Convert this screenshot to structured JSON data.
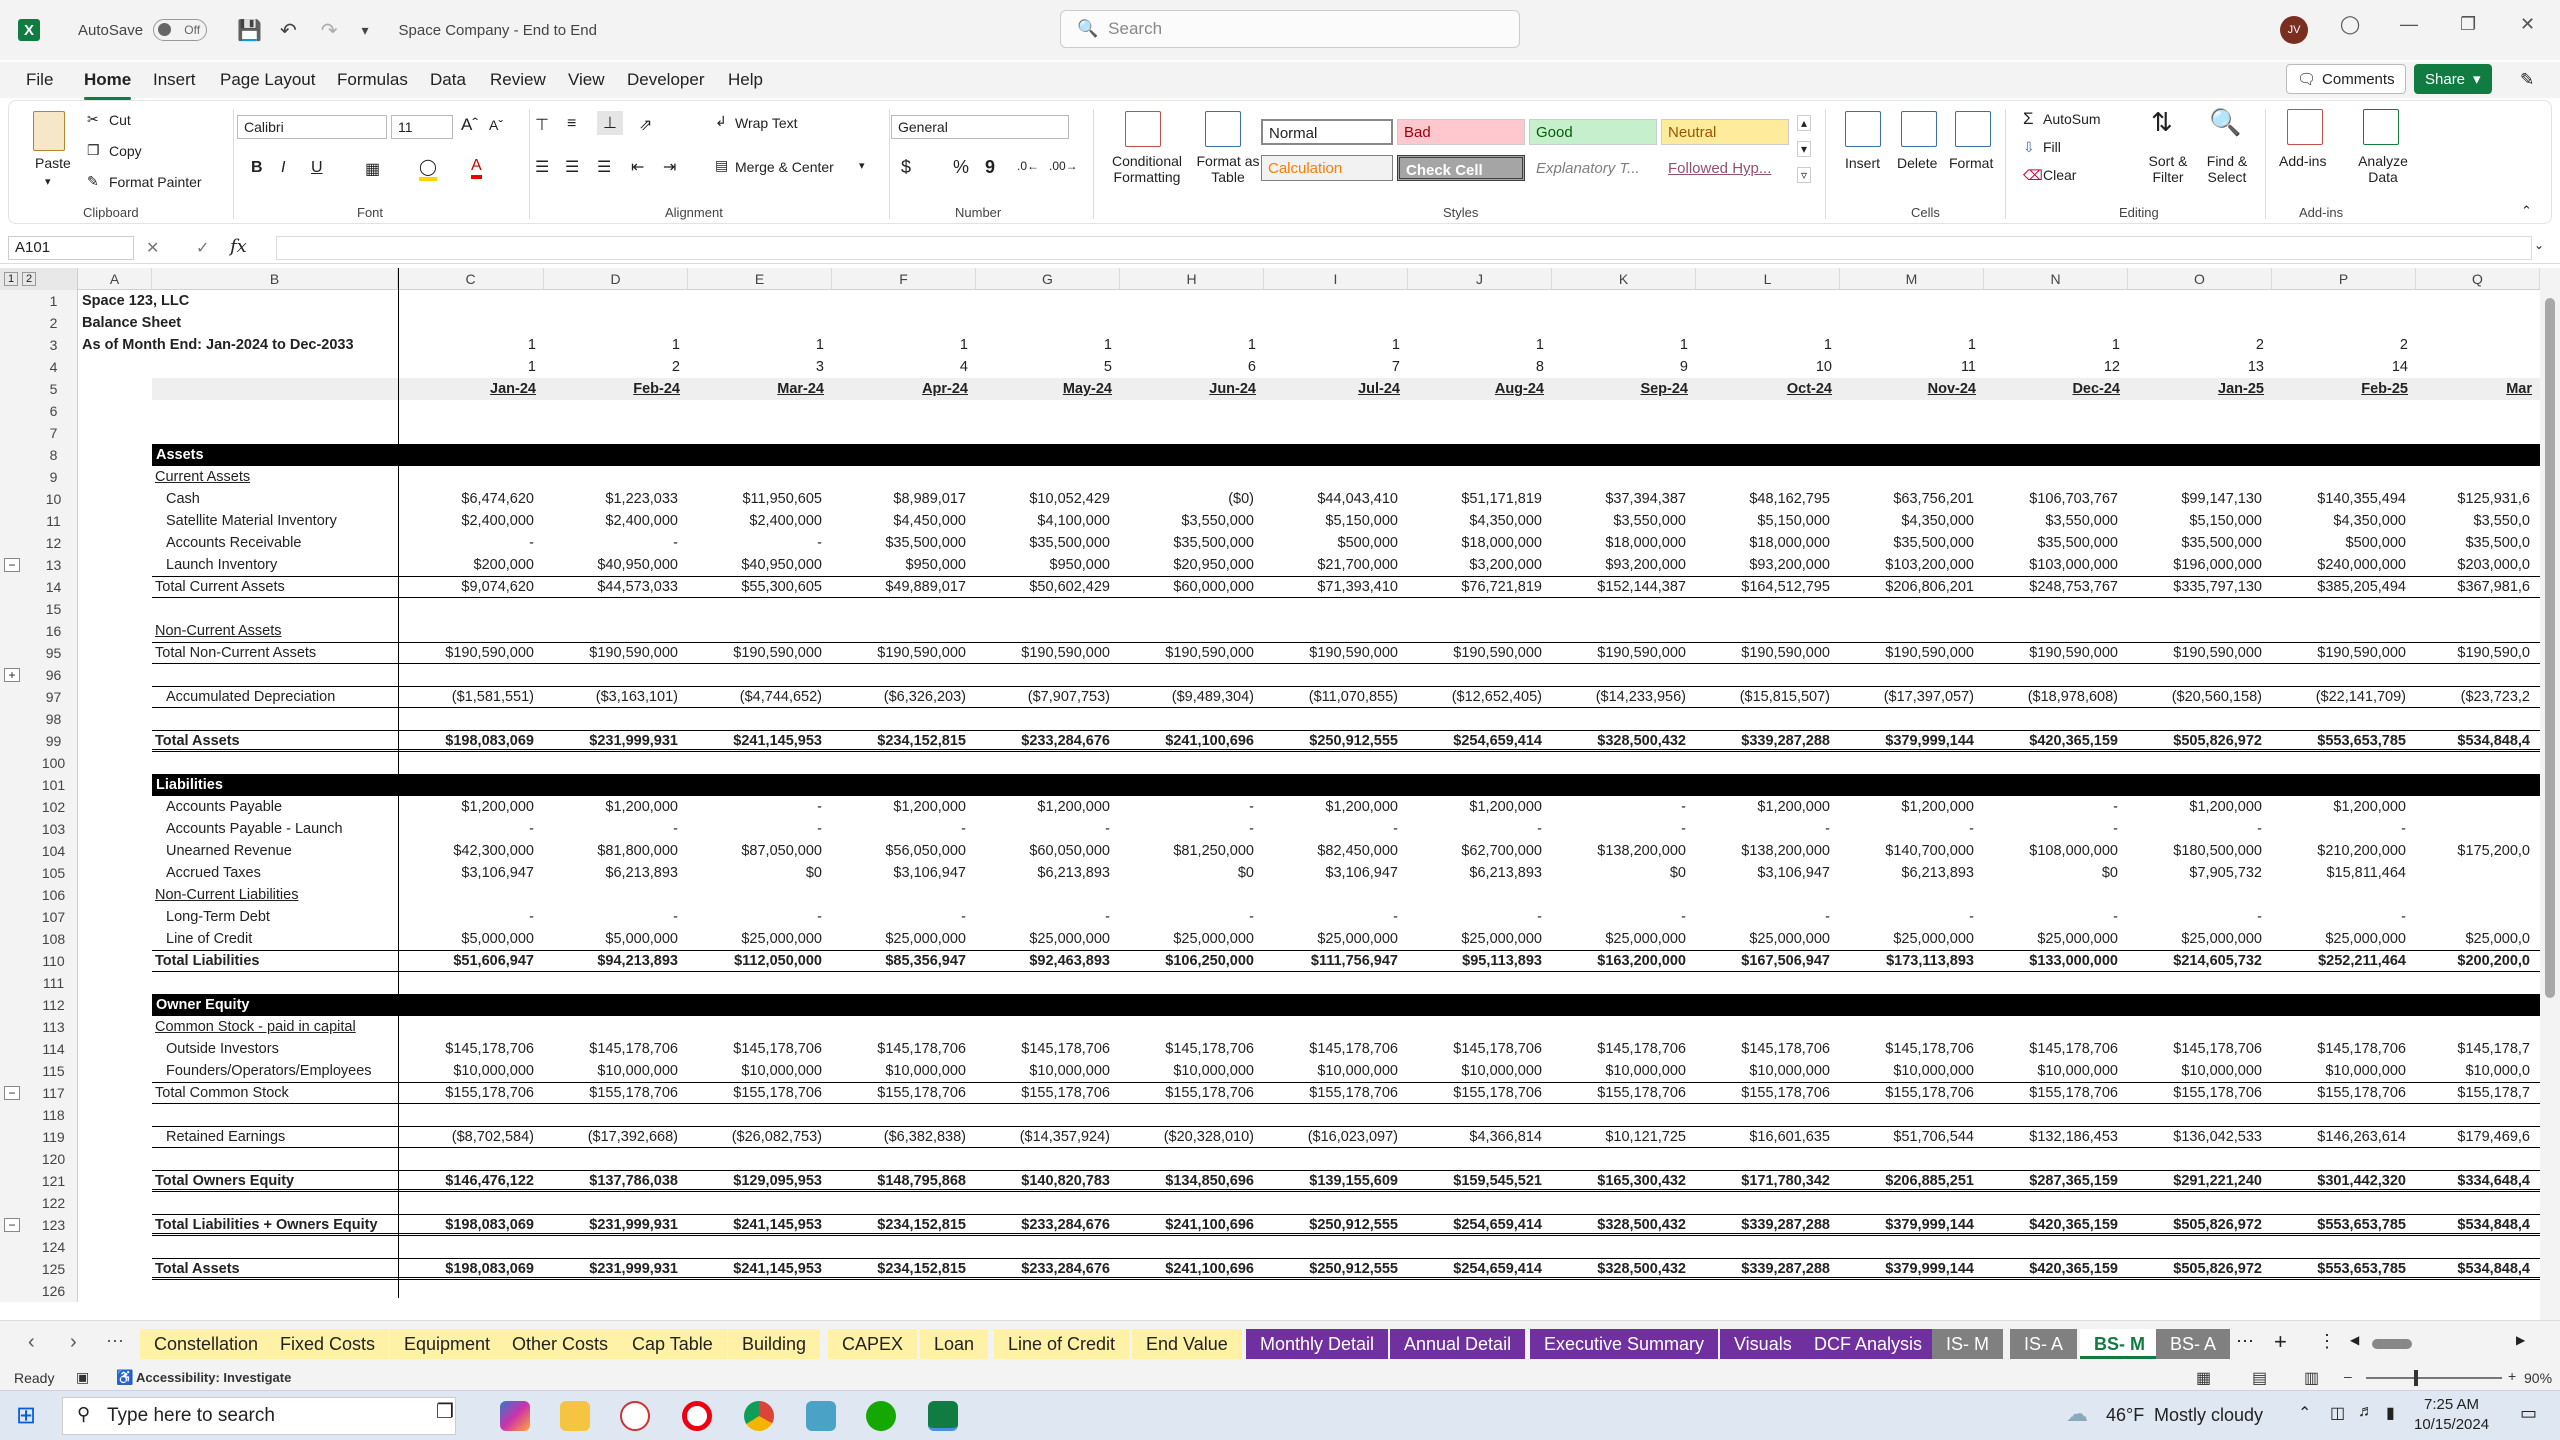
{
  "title_bar": {
    "autosave_label": "AutoSave",
    "autosave_state": "Off",
    "document_title": "Space Company - End to End",
    "search_placeholder": "Search",
    "user_initials": "JV"
  },
  "menu": {
    "items": [
      "File",
      "Home",
      "Insert",
      "Page Layout",
      "Formulas",
      "Data",
      "Review",
      "View",
      "Developer",
      "Help"
    ],
    "active": "Home",
    "comments_label": "Comments",
    "share_label": "Share"
  },
  "ribbon": {
    "clipboard": {
      "paste": "Paste",
      "cut": "Cut",
      "copy": "Copy",
      "format_painter": "Format Painter",
      "group": "Clipboard"
    },
    "font": {
      "name": "Calibri",
      "size": "11",
      "group": "Font"
    },
    "alignment": {
      "wrap_text": "Wrap Text",
      "merge_center": "Merge & Center",
      "group": "Alignment"
    },
    "number": {
      "format": "General",
      "group": "Number"
    },
    "styles": {
      "conditional_formatting": "Conditional Formatting",
      "format_as_table": "Format as Table",
      "cells": [
        "Normal",
        "Bad",
        "Good",
        "Neutral",
        "Calculation",
        "Check Cell",
        "Explanatory T...",
        "Followed Hyp..."
      ],
      "group": "Styles"
    },
    "cells": {
      "insert": "Insert",
      "delete": "Delete",
      "format": "Format",
      "group": "Cells"
    },
    "editing": {
      "autosum": "AutoSum",
      "fill": "Fill",
      "clear": "Clear",
      "sort_filter": "Sort & Filter",
      "find_select": "Find & Select",
      "group": "Editing"
    },
    "addins": {
      "addins": "Add-ins",
      "analyze": "Analyze Data",
      "group": "Add-ins"
    }
  },
  "formula_bar": {
    "name_box": "A101",
    "formula": ""
  },
  "columns": [
    "A",
    "B",
    "C",
    "D",
    "E",
    "F",
    "G",
    "H",
    "I",
    "J",
    "K",
    "L",
    "M",
    "N",
    "O",
    "P",
    "Q"
  ],
  "sheet": {
    "company": "Space 123, LLC",
    "statement": "Balance Sheet",
    "period": "As of Month End: Jan-2024 to Dec-2033",
    "year_index": [
      "1",
      "1",
      "1",
      "1",
      "1",
      "1",
      "1",
      "1",
      "1",
      "1",
      "1",
      "1",
      "2",
      "2",
      ""
    ],
    "month_index": [
      "1",
      "2",
      "3",
      "4",
      "5",
      "6",
      "7",
      "8",
      "9",
      "10",
      "11",
      "12",
      "13",
      "14",
      ""
    ],
    "months": [
      "Jan-24",
      "Feb-24",
      "Mar-24",
      "Apr-24",
      "May-24",
      "Jun-24",
      "Jul-24",
      "Aug-24",
      "Sep-24",
      "Oct-24",
      "Nov-24",
      "Dec-24",
      "Jan-25",
      "Feb-25",
      "Mar"
    ],
    "rows": [
      {
        "n": "6",
        "type": "blank"
      },
      {
        "n": "7",
        "type": "blank"
      },
      {
        "n": "8",
        "type": "header",
        "label": "Assets"
      },
      {
        "n": "9",
        "type": "sub",
        "label": "Current Assets"
      },
      {
        "n": "10",
        "type": "item",
        "label": "Cash",
        "values": [
          "$6,474,620",
          "$1,223,033",
          "$11,950,605",
          "$8,989,017",
          "$10,052,429",
          "($0)",
          "$44,043,410",
          "$51,171,819",
          "$37,394,387",
          "$48,162,795",
          "$63,756,201",
          "$106,703,767",
          "$99,147,130",
          "$140,355,494",
          "$125,931,6"
        ]
      },
      {
        "n": "11",
        "type": "item",
        "label": "Satellite Material Inventory",
        "values": [
          "$2,400,000",
          "$2,400,000",
          "$2,400,000",
          "$4,450,000",
          "$4,100,000",
          "$3,550,000",
          "$5,150,000",
          "$4,350,000",
          "$3,550,000",
          "$5,150,000",
          "$4,350,000",
          "$3,550,000",
          "$5,150,000",
          "$4,350,000",
          "$3,550,0"
        ]
      },
      {
        "n": "12",
        "type": "item",
        "label": "Accounts Receivable",
        "values": [
          "-",
          "-",
          "-",
          "$35,500,000",
          "$35,500,000",
          "$35,500,000",
          "$500,000",
          "$18,000,000",
          "$18,000,000",
          "$18,000,000",
          "$35,500,000",
          "$35,500,000",
          "$35,500,000",
          "$500,000",
          "$35,500,0"
        ]
      },
      {
        "n": "13",
        "type": "item",
        "label": "Launch Inventory",
        "values": [
          "$200,000",
          "$40,950,000",
          "$40,950,000",
          "$950,000",
          "$950,000",
          "$20,950,000",
          "$21,700,000",
          "$3,200,000",
          "$93,200,000",
          "$93,200,000",
          "$103,200,000",
          "$103,000,000",
          "$196,000,000",
          "$240,000,000",
          "$203,000,0"
        ]
      },
      {
        "n": "14",
        "type": "total",
        "label": "Total Current Assets",
        "values": [
          "$9,074,620",
          "$44,573,033",
          "$55,300,605",
          "$49,889,017",
          "$50,602,429",
          "$60,000,000",
          "$71,393,410",
          "$76,721,819",
          "$152,144,387",
          "$164,512,795",
          "$206,806,201",
          "$248,753,767",
          "$335,797,130",
          "$385,205,494",
          "$367,981,6"
        ]
      },
      {
        "n": "15",
        "type": "blank"
      },
      {
        "n": "16",
        "type": "sub",
        "label": "Non-Current Assets"
      },
      {
        "n": "95",
        "type": "total",
        "label": "Total Non-Current Assets",
        "values": [
          "$190,590,000",
          "$190,590,000",
          "$190,590,000",
          "$190,590,000",
          "$190,590,000",
          "$190,590,000",
          "$190,590,000",
          "$190,590,000",
          "$190,590,000",
          "$190,590,000",
          "$190,590,000",
          "$190,590,000",
          "$190,590,000",
          "$190,590,000",
          "$190,590,0"
        ]
      },
      {
        "n": "96",
        "type": "blank"
      },
      {
        "n": "97",
        "type": "boxed",
        "label": "Accumulated Depreciation",
        "values": [
          "($1,581,551)",
          "($3,163,101)",
          "($4,744,652)",
          "($6,326,203)",
          "($7,907,753)",
          "($9,489,304)",
          "($11,070,855)",
          "($12,652,405)",
          "($14,233,956)",
          "($15,815,507)",
          "($17,397,057)",
          "($18,978,608)",
          "($20,560,158)",
          "($22,141,709)",
          "($23,723,2"
        ]
      },
      {
        "n": "98",
        "type": "blank"
      },
      {
        "n": "99",
        "type": "grand",
        "label": "Total Assets",
        "values": [
          "$198,083,069",
          "$231,999,931",
          "$241,145,953",
          "$234,152,815",
          "$233,284,676",
          "$241,100,696",
          "$250,912,555",
          "$254,659,414",
          "$328,500,432",
          "$339,287,288",
          "$379,999,144",
          "$420,365,159",
          "$505,826,972",
          "$553,653,785",
          "$534,848,4"
        ]
      },
      {
        "n": "100",
        "type": "blank"
      },
      {
        "n": "101",
        "type": "header",
        "label": "Liabilities"
      },
      {
        "n": "102",
        "type": "item",
        "label": "Accounts Payable",
        "values": [
          "$1,200,000",
          "$1,200,000",
          "-",
          "$1,200,000",
          "$1,200,000",
          "-",
          "$1,200,000",
          "$1,200,000",
          "-",
          "$1,200,000",
          "$1,200,000",
          "-",
          "$1,200,000",
          "$1,200,000",
          ""
        ]
      },
      {
        "n": "103",
        "type": "item",
        "label": "Accounts Payable - Launch",
        "values": [
          "-",
          "-",
          "-",
          "-",
          "-",
          "-",
          "-",
          "-",
          "-",
          "-",
          "-",
          "-",
          "-",
          "-",
          ""
        ]
      },
      {
        "n": "104",
        "type": "item",
        "label": "Unearned Revenue",
        "values": [
          "$42,300,000",
          "$81,800,000",
          "$87,050,000",
          "$56,050,000",
          "$60,050,000",
          "$81,250,000",
          "$82,450,000",
          "$62,700,000",
          "$138,200,000",
          "$138,200,000",
          "$140,700,000",
          "$108,000,000",
          "$180,500,000",
          "$210,200,000",
          "$175,200,0"
        ]
      },
      {
        "n": "105",
        "type": "item",
        "label": "Accrued Taxes",
        "values": [
          "$3,106,947",
          "$6,213,893",
          "$0",
          "$3,106,947",
          "$6,213,893",
          "$0",
          "$3,106,947",
          "$6,213,893",
          "$0",
          "$3,106,947",
          "$6,213,893",
          "$0",
          "$7,905,732",
          "$15,811,464",
          ""
        ]
      },
      {
        "n": "106",
        "type": "sub",
        "label": "Non-Current Liabilities"
      },
      {
        "n": "107",
        "type": "item",
        "label": "Long-Term Debt",
        "values": [
          "-",
          "-",
          "-",
          "-",
          "-",
          "-",
          "-",
          "-",
          "-",
          "-",
          "-",
          "-",
          "-",
          "-",
          ""
        ]
      },
      {
        "n": "108",
        "type": "item",
        "label": "Line of Credit",
        "values": [
          "$5,000,000",
          "$5,000,000",
          "$25,000,000",
          "$25,000,000",
          "$25,000,000",
          "$25,000,000",
          "$25,000,000",
          "$25,000,000",
          "$25,000,000",
          "$25,000,000",
          "$25,000,000",
          "$25,000,000",
          "$25,000,000",
          "$25,000,000",
          "$25,000,0"
        ]
      },
      {
        "n": "110",
        "type": "total",
        "label": "Total Liabilities",
        "bold": true,
        "values": [
          "$51,606,947",
          "$94,213,893",
          "$112,050,000",
          "$85,356,947",
          "$92,463,893",
          "$106,250,000",
          "$111,756,947",
          "$95,113,893",
          "$163,200,000",
          "$167,506,947",
          "$173,113,893",
          "$133,000,000",
          "$214,605,732",
          "$252,211,464",
          "$200,200,0"
        ]
      },
      {
        "n": "111",
        "type": "blank"
      },
      {
        "n": "112",
        "type": "header",
        "label": "Owner Equity"
      },
      {
        "n": "113",
        "type": "sub",
        "label": "Common Stock - paid in capital"
      },
      {
        "n": "114",
        "type": "item",
        "label": "Outside Investors",
        "values": [
          "$145,178,706",
          "$145,178,706",
          "$145,178,706",
          "$145,178,706",
          "$145,178,706",
          "$145,178,706",
          "$145,178,706",
          "$145,178,706",
          "$145,178,706",
          "$145,178,706",
          "$145,178,706",
          "$145,178,706",
          "$145,178,706",
          "$145,178,706",
          "$145,178,7"
        ]
      },
      {
        "n": "115",
        "type": "item",
        "label": "Founders/Operators/Employees",
        "values": [
          "$10,000,000",
          "$10,000,000",
          "$10,000,000",
          "$10,000,000",
          "$10,000,000",
          "$10,000,000",
          "$10,000,000",
          "$10,000,000",
          "$10,000,000",
          "$10,000,000",
          "$10,000,000",
          "$10,000,000",
          "$10,000,000",
          "$10,000,000",
          "$10,000,0"
        ]
      },
      {
        "n": "117",
        "type": "total",
        "label": "Total Common Stock",
        "values": [
          "$155,178,706",
          "$155,178,706",
          "$155,178,706",
          "$155,178,706",
          "$155,178,706",
          "$155,178,706",
          "$155,178,706",
          "$155,178,706",
          "$155,178,706",
          "$155,178,706",
          "$155,178,706",
          "$155,178,706",
          "$155,178,706",
          "$155,178,706",
          "$155,178,7"
        ]
      },
      {
        "n": "118",
        "type": "blank"
      },
      {
        "n": "119",
        "type": "boxed",
        "label": "Retained Earnings",
        "values": [
          "($8,702,584)",
          "($17,392,668)",
          "($26,082,753)",
          "($6,382,838)",
          "($14,357,924)",
          "($20,328,010)",
          "($16,023,097)",
          "$4,366,814",
          "$10,121,725",
          "$16,601,635",
          "$51,706,544",
          "$132,186,453",
          "$136,042,533",
          "$146,263,614",
          "$179,469,6"
        ]
      },
      {
        "n": "120",
        "type": "blank"
      },
      {
        "n": "121",
        "type": "grand",
        "label": "Total Owners Equity",
        "values": [
          "$146,476,122",
          "$137,786,038",
          "$129,095,953",
          "$148,795,868",
          "$140,820,783",
          "$134,850,696",
          "$139,155,609",
          "$159,545,521",
          "$165,300,432",
          "$171,780,342",
          "$206,885,251",
          "$287,365,159",
          "$291,221,240",
          "$301,442,320",
          "$334,648,4"
        ]
      },
      {
        "n": "122",
        "type": "blank"
      },
      {
        "n": "123",
        "type": "grand",
        "label": "Total Liabilities + Owners Equity",
        "values": [
          "$198,083,069",
          "$231,999,931",
          "$241,145,953",
          "$234,152,815",
          "$233,284,676",
          "$241,100,696",
          "$250,912,555",
          "$254,659,414",
          "$328,500,432",
          "$339,287,288",
          "$379,999,144",
          "$420,365,159",
          "$505,826,972",
          "$553,653,785",
          "$534,848,4"
        ]
      },
      {
        "n": "124",
        "type": "blank"
      },
      {
        "n": "125",
        "type": "grand",
        "label": "Total Assets",
        "values": [
          "$198,083,069",
          "$231,999,931",
          "$241,145,953",
          "$234,152,815",
          "$233,284,676",
          "$241,100,696",
          "$250,912,555",
          "$254,659,414",
          "$328,500,432",
          "$339,287,288",
          "$379,999,144",
          "$420,365,159",
          "$505,826,972",
          "$553,653,785",
          "$534,848,4"
        ]
      },
      {
        "n": "126",
        "type": "blank"
      }
    ]
  },
  "sheet_tabs": [
    {
      "name": "Constellation",
      "color": "yellow"
    },
    {
      "name": "Fixed Costs",
      "color": "yellow"
    },
    {
      "name": "Equipment",
      "color": "yellow"
    },
    {
      "name": "Other Costs",
      "color": "yellow"
    },
    {
      "name": "Cap Table",
      "color": "yellow"
    },
    {
      "name": "Building",
      "color": "yellow"
    },
    {
      "name": "CAPEX",
      "color": "yellow"
    },
    {
      "name": "Loan",
      "color": "yellow"
    },
    {
      "name": "Line of Credit",
      "color": "yellow"
    },
    {
      "name": "End Value",
      "color": "yellow"
    },
    {
      "name": "Monthly Detail",
      "color": "purple"
    },
    {
      "name": "Annual Detail",
      "color": "purple"
    },
    {
      "name": "Executive Summary",
      "color": "purple"
    },
    {
      "name": "Visuals",
      "color": "purple"
    },
    {
      "name": "DCF Analysis",
      "color": "purple"
    },
    {
      "name": "IS- M",
      "color": "gray"
    },
    {
      "name": "IS- A",
      "color": "gray"
    },
    {
      "name": "BS- M",
      "color": "active"
    },
    {
      "name": "BS- A",
      "color": "gray"
    }
  ],
  "status_bar": {
    "ready": "Ready",
    "accessibility": "Accessibility: Investigate",
    "zoom": "90%"
  },
  "taskbar": {
    "search_placeholder": "Type here to search",
    "weather_temp": "46°F",
    "weather_desc": "Mostly cloudy",
    "time": "7:25 AM",
    "date": "10/15/2024"
  },
  "colors": {
    "excel_green": "#107c41",
    "tab_yellow": "#fff2a6",
    "tab_purple": "#7030a0",
    "tab_gray": "#808080"
  }
}
